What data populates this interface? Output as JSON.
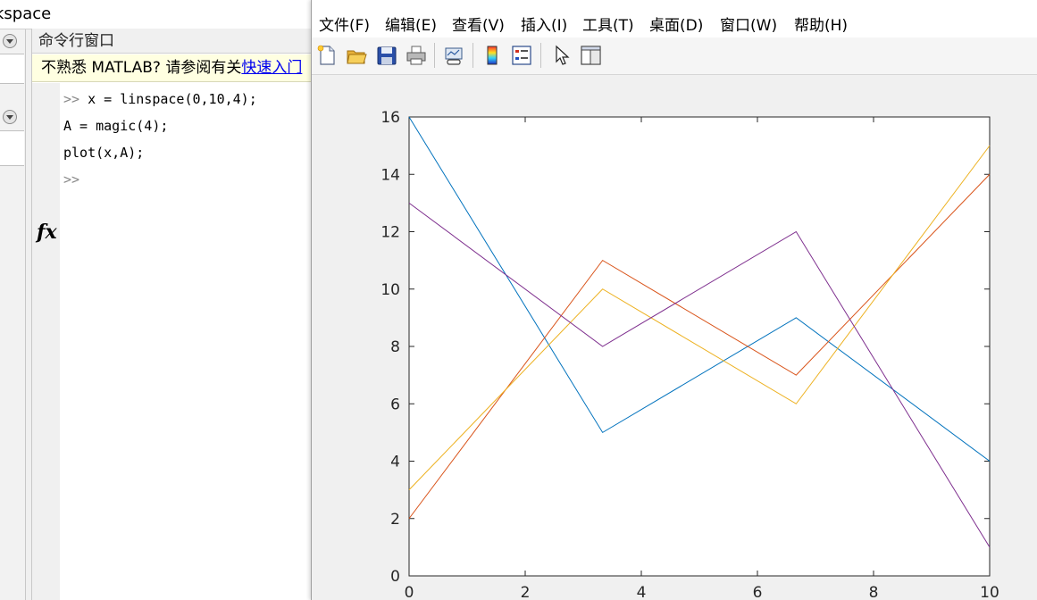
{
  "workspace": {
    "title": "kspace"
  },
  "command_window": {
    "header": "命令行窗口",
    "notice_text": "不熟悉 MATLAB? 请参阅有关",
    "notice_link": "快速入门",
    "lines": [
      {
        "prompt": ">> ",
        "code": "x = linspace(0,10,4);"
      },
      {
        "prompt": "",
        "code": "A = magic(4);"
      },
      {
        "prompt": "",
        "code": "plot(x,A);"
      },
      {
        "prompt": ">>",
        "code": ""
      }
    ],
    "fx_label": "fx"
  },
  "figure": {
    "menu": [
      "文件(F)",
      "编辑(E)",
      "查看(V)",
      "插入(I)",
      "工具(T)",
      "桌面(D)",
      "窗口(W)",
      "帮助(H)"
    ],
    "toolbar_icons": [
      "new-figure-icon",
      "open-file-icon",
      "save-icon",
      "print-icon",
      "link-plot-icon",
      "colorbar-icon",
      "legend-icon",
      "pointer-icon",
      "property-editor-icon"
    ]
  },
  "chart_data": {
    "type": "line",
    "x": [
      0,
      3.3333,
      6.6667,
      10
    ],
    "series": [
      {
        "values": [
          16,
          5,
          9,
          4
        ],
        "color": "#0072BD"
      },
      {
        "values": [
          2,
          11,
          7,
          14
        ],
        "color": "#D95319"
      },
      {
        "values": [
          3,
          10,
          6,
          15
        ],
        "color": "#EDB120"
      },
      {
        "values": [
          13,
          8,
          12,
          1
        ],
        "color": "#7E2F8E"
      }
    ],
    "xlim": [
      0,
      10
    ],
    "ylim": [
      0,
      16
    ],
    "xticks": [
      0,
      2,
      4,
      6,
      8,
      10
    ],
    "yticks": [
      0,
      2,
      4,
      6,
      8,
      10,
      12,
      14,
      16
    ],
    "title": "",
    "xlabel": "",
    "ylabel": "",
    "grid": false
  }
}
